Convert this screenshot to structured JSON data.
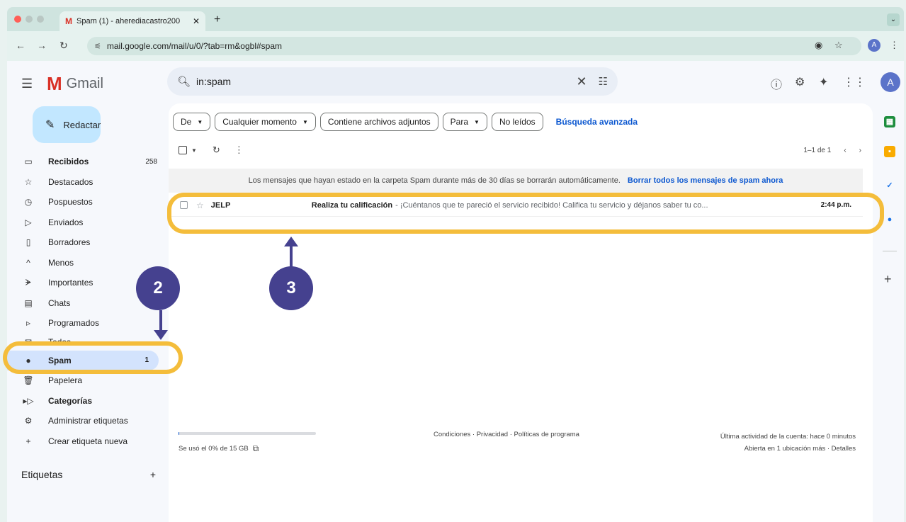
{
  "browser": {
    "tab_title": "Spam (1) - aherediacastro200",
    "tab_icon": "M",
    "url": "mail.google.com/mail/u/0/?tab=rm&ogbl#spam",
    "profile_letter": "A"
  },
  "gmail": {
    "logo_letter": "M",
    "logo_text": "Gmail",
    "search_value": "in:spam",
    "avatar_letter": "A",
    "compose_label": "Redactar"
  },
  "sidebar": {
    "items": [
      {
        "label": "Recibidos",
        "count": "258",
        "icon": "inbox-icon"
      },
      {
        "label": "Destacados",
        "count": "",
        "icon": "star-icon"
      },
      {
        "label": "Pospuestos",
        "count": "",
        "icon": "clock-icon"
      },
      {
        "label": "Enviados",
        "count": "",
        "icon": "send-icon"
      },
      {
        "label": "Borradores",
        "count": "",
        "icon": "draft-icon"
      },
      {
        "label": "Menos",
        "count": "",
        "icon": "chevron-up-icon"
      },
      {
        "label": "Importantes",
        "count": "",
        "icon": "important-icon"
      },
      {
        "label": "Chats",
        "count": "",
        "icon": "chat-icon"
      },
      {
        "label": "Programados",
        "count": "",
        "icon": "scheduled-icon"
      },
      {
        "label": "Todos",
        "count": "",
        "icon": "all-mail-icon"
      },
      {
        "label": "Spam",
        "count": "1",
        "icon": "spam-icon"
      },
      {
        "label": "Papelera",
        "count": "",
        "icon": "trash-icon"
      },
      {
        "label": "Categorías",
        "count": "",
        "icon": "label-icon"
      },
      {
        "label": "Administrar etiquetas",
        "count": "",
        "icon": "gear-icon"
      },
      {
        "label": "Crear etiqueta nueva",
        "count": "",
        "icon": "plus-icon"
      }
    ],
    "labels_heading": "Etiquetas"
  },
  "filters": {
    "from": "De",
    "any_time": "Cualquier momento",
    "has_attachment": "Contiene archivos adjuntos",
    "to": "Para",
    "unread": "No leídos",
    "advanced": "Búsqueda avanzada"
  },
  "toolbar": {
    "pagination": "1–1 de 1"
  },
  "notice": {
    "text": "Los mensajes que hayan estado en la carpeta Spam durante más de 30 días se borrarán automáticamente.",
    "link": "Borrar todos los mensajes de spam ahora"
  },
  "messages": [
    {
      "sender": "JELP",
      "subject": "Realiza tu calificación",
      "snippet": "- ¡Cuéntanos que te pareció el servicio recibido! Califica tu servicio y déjanos saber tu co...",
      "time": "2:44 p.m."
    }
  ],
  "footer": {
    "storage": "Se usó el 0% de 15 GB",
    "storage_percent": 0,
    "terms": "Condiciones · Privacidad · Políticas de programa",
    "activity": "Última actividad de la cuenta: hace 0 minutos",
    "details": "Abierta en 1 ubicación más · Detalles"
  },
  "annotations": {
    "step_2": "2",
    "step_3": "3",
    "highlight_color": "#f4bd3b",
    "badge_color": "#45418f"
  },
  "colors": {
    "accent": "#0b57d0",
    "compose_bg": "#c2e7ff",
    "active_nav": "#d3e3fd",
    "gmail_red": "#d93025"
  }
}
